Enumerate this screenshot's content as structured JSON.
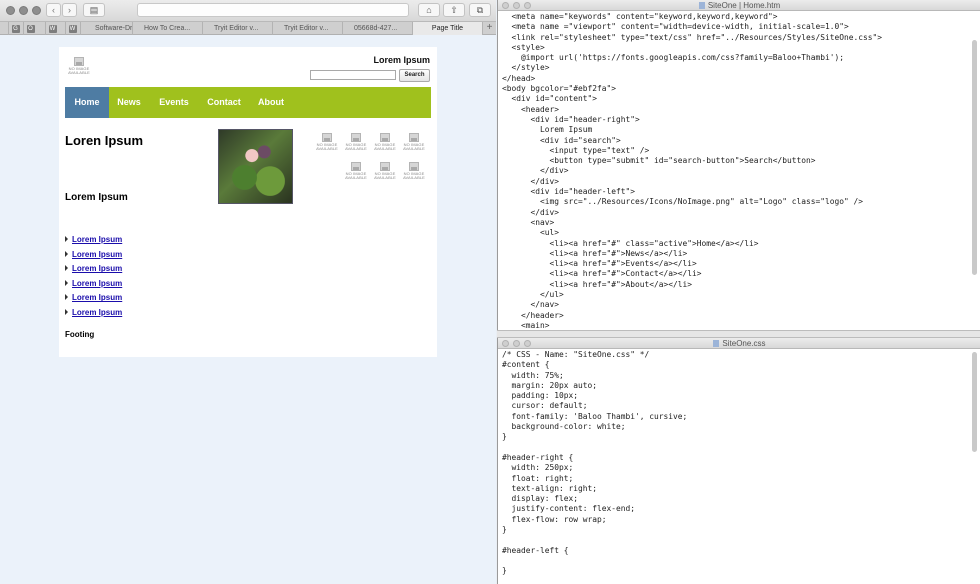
{
  "browser": {
    "tabs": [
      {
        "label": "G",
        "pinned": true
      },
      {
        "label": "O",
        "pinned": true
      },
      {
        "label": "W",
        "pinned": true
      },
      {
        "label": "W",
        "pinned": true
      },
      {
        "label": "Software-Dr"
      },
      {
        "label": "How To Crea..."
      },
      {
        "label": "Tryit Editor v..."
      },
      {
        "label": "Tryit Editor v..."
      },
      {
        "label": "05668d-427..."
      },
      {
        "label": "Page Title",
        "active": true
      }
    ],
    "new_tab_label": "+"
  },
  "site": {
    "logo_caption": "NO IMAGE AVAILABLE",
    "header_title": "Lorem Ipsum",
    "search_button": "Search",
    "nav": [
      "Home",
      "News",
      "Events",
      "Contact",
      "About"
    ],
    "main_heading": "Loren Ipsum",
    "sub_heading": "Lorem Ipsum",
    "thumb_caption": "NO IMAGE AVAILABLE",
    "links": [
      "Lorem Ipsum",
      "Lorem Ipsum",
      "Lorem Ipsum",
      "Lorem Ipsum",
      "Lorem Ipsum",
      "Lorem Ipsum"
    ],
    "footing": "Footing"
  },
  "editor_html": {
    "title": "SiteOne | Home.htm",
    "lines": [
      "  <meta name=\"keywords\" content=\"keyword,keyword,keyword\">",
      "  <meta name =\"viewport\" content=\"width=device-width, initial-scale=1.0\">",
      "  <link rel=\"stylesheet\" type=\"text/css\" href=\"../Resources/Styles/SiteOne.css\">",
      "  <style>",
      "    @import url('https://fonts.googleapis.com/css?family=Baloo+Thambi');",
      "  </style>",
      "</head>",
      "<body bgcolor=\"#ebf2fa\">",
      "  <div id=\"content\">",
      "    <header>",
      "      <div id=\"header-right\">",
      "        Lorem Ipsum",
      "        <div id=\"search\">",
      "          <input type=\"text\" />",
      "          <button type=\"submit\" id=\"search-button\">Search</button>",
      "        </div>",
      "      </div>",
      "      <div id=\"header-left\">",
      "        <img src=\"../Resources/Icons/NoImage.png\" alt=\"Logo\" class=\"logo\" />",
      "      </div>",
      "      <nav>",
      "        <ul>",
      "          <li><a href=\"#\" class=\"active\">Home</a></li>",
      "          <li><a href=\"#\">News</a></li>",
      "          <li><a href=\"#\">Events</a></li>",
      "          <li><a href=\"#\">Contact</a></li>",
      "          <li><a href=\"#\">About</a></li>",
      "        </ul>",
      "      </nav>",
      "    </header>",
      "    <main>"
    ]
  },
  "editor_css": {
    "title": "SiteOne.css",
    "lines": [
      "/* CSS - Name: \"SiteOne.css\" */",
      "#content {",
      "  width: 75%;",
      "  margin: 20px auto;",
      "  padding: 10px;",
      "  cursor: default;",
      "  font-family: 'Baloo Thambi', cursive;",
      "  background-color: white;",
      "}",
      "",
      "#header-right {",
      "  width: 250px;",
      "  float: right;",
      "  text-align: right;",
      "  display: flex;",
      "  justify-content: flex-end;",
      "  flex-flow: row wrap;",
      "}",
      "",
      "#header-left {",
      "",
      "}"
    ]
  },
  "colors": {
    "nav_bar": "#a0c11d",
    "nav_active": "#4e7ca3",
    "page_bg": "#ebf2fa",
    "link": "#1a0dab"
  }
}
